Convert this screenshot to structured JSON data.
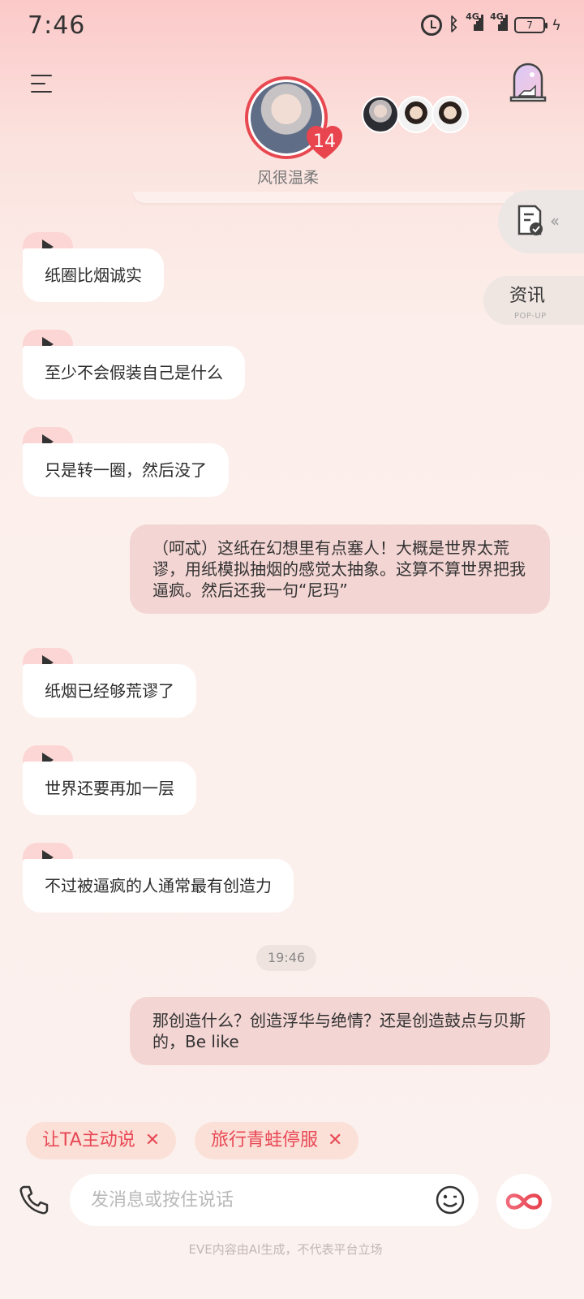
{
  "status_bar": {
    "time": "7:46",
    "network_1": "4G",
    "network_2": "4G",
    "battery_level": "7"
  },
  "header": {
    "character_name": "风很温柔",
    "affinity_level": "14"
  },
  "side_tabs": {
    "news_label": "资讯",
    "news_sub_label": "POP-UP"
  },
  "messages": [
    {
      "role": "ai",
      "text": "纸圈比烟诚实"
    },
    {
      "role": "ai",
      "text": "至少不会假装自己是什么"
    },
    {
      "role": "ai",
      "text": "只是转一圈，然后没了"
    },
    {
      "role": "user",
      "text": "（呵忒）这纸在幻想里有点塞人！大概是世界太荒谬，用纸模拟抽烟的感觉太抽象。这算不算世界把我逼疯。然后还我一句“尼玛”"
    },
    {
      "role": "ai",
      "text": "纸烟已经够荒谬了"
    },
    {
      "role": "ai",
      "text": "世界还要再加一层"
    },
    {
      "role": "ai",
      "text": "不过被逼疯的人通常最有创造力"
    },
    {
      "role": "time",
      "text": "19:46"
    },
    {
      "role": "user",
      "text": "那创造什么？创造浮华与绝情？还是创造鼓点与贝斯的，Be like"
    }
  ],
  "suggestion_chips": [
    {
      "label": "让TA主动说",
      "close": "✕"
    },
    {
      "label": "旅行青蛙停服",
      "close": "✕"
    }
  ],
  "input": {
    "placeholder": "发消息或按住说话"
  },
  "footer": {
    "disclaimer": "EVE内容由AI生成，不代表平台立场"
  },
  "colors": {
    "accent": "#e84855",
    "user_bubble": "#f3d5d3",
    "ai_bubble": "#ffffff",
    "play_tab": "#fbd6d4",
    "chip_bg": "#fbe0d7"
  },
  "icons": [
    "menu-icon",
    "gallery-icon",
    "document-check-icon",
    "phone-icon",
    "emoji-icon",
    "infinity-icon",
    "play-icon",
    "heart-icon",
    "close-icon"
  ]
}
